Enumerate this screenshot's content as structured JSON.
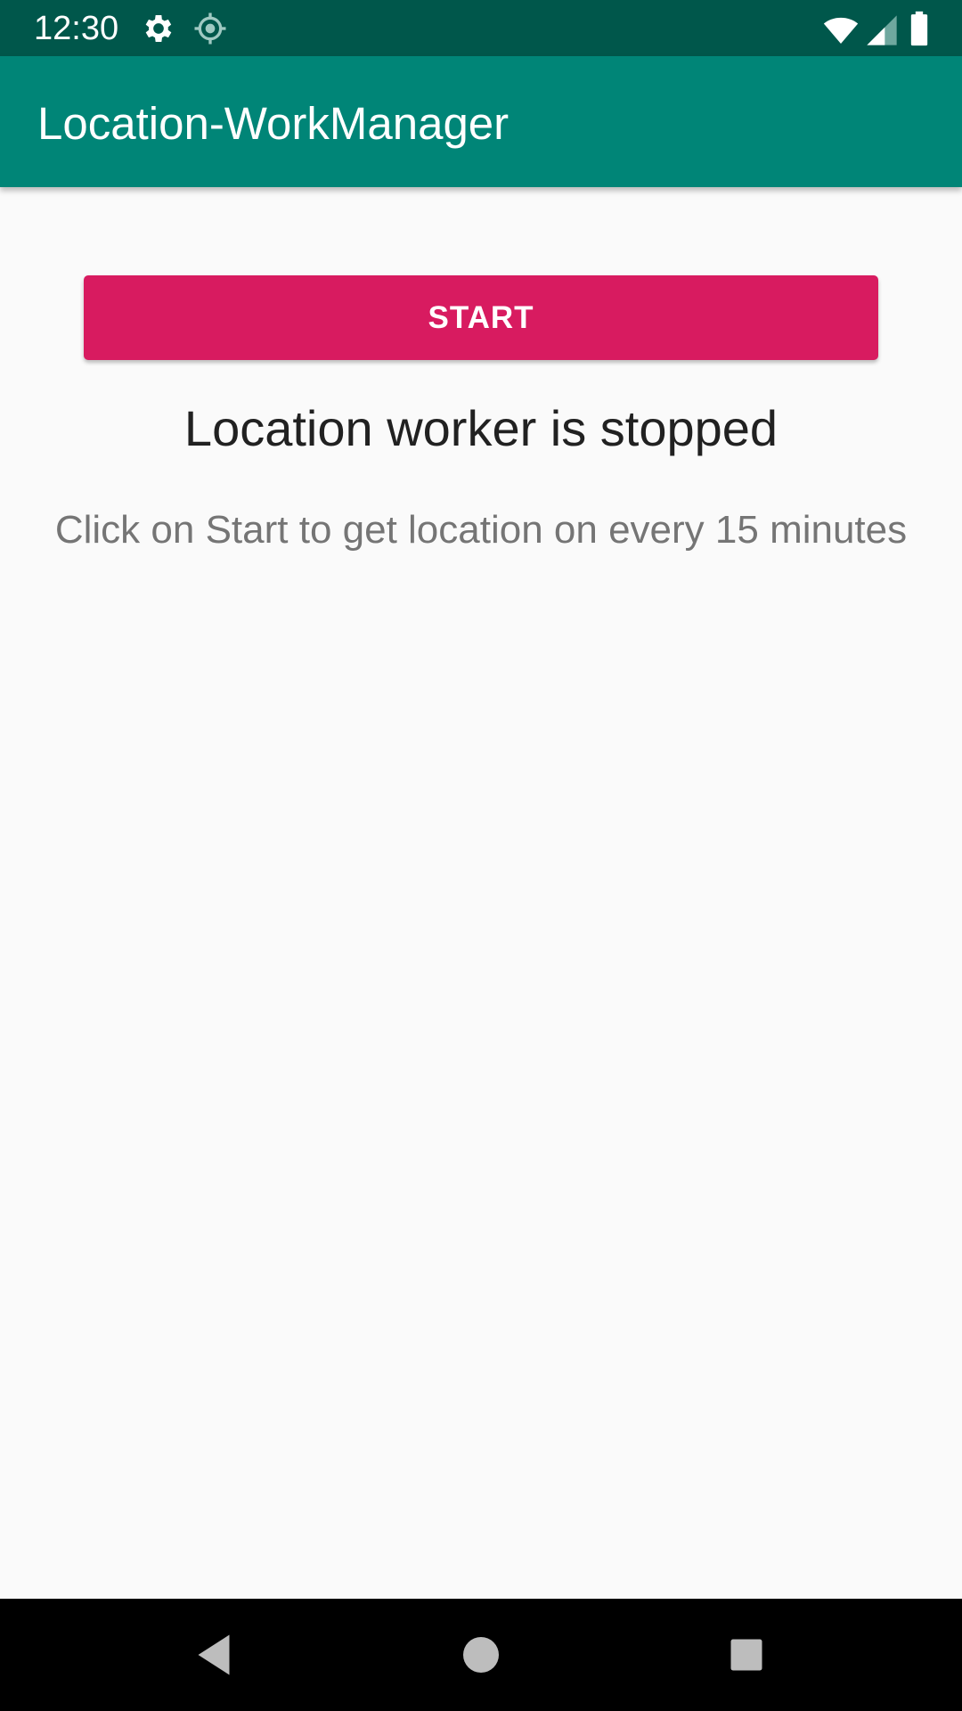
{
  "status_bar": {
    "time": "12:30",
    "icons": [
      "gear-icon",
      "location-icon",
      "wifi-icon",
      "signal-icon",
      "battery-icon"
    ]
  },
  "app_bar": {
    "title": "Location-WorkManager"
  },
  "main": {
    "start_label": "START",
    "status_message": "Location worker is stopped",
    "hint": "Click on Start to get location on every 15 minutes"
  },
  "nav_bar": {
    "icons": [
      "back-icon",
      "home-icon",
      "recents-icon"
    ]
  },
  "colors": {
    "status_bar": "#00574b",
    "app_bar": "#008577",
    "accent": "#d81b60",
    "background": "#fafafa"
  }
}
